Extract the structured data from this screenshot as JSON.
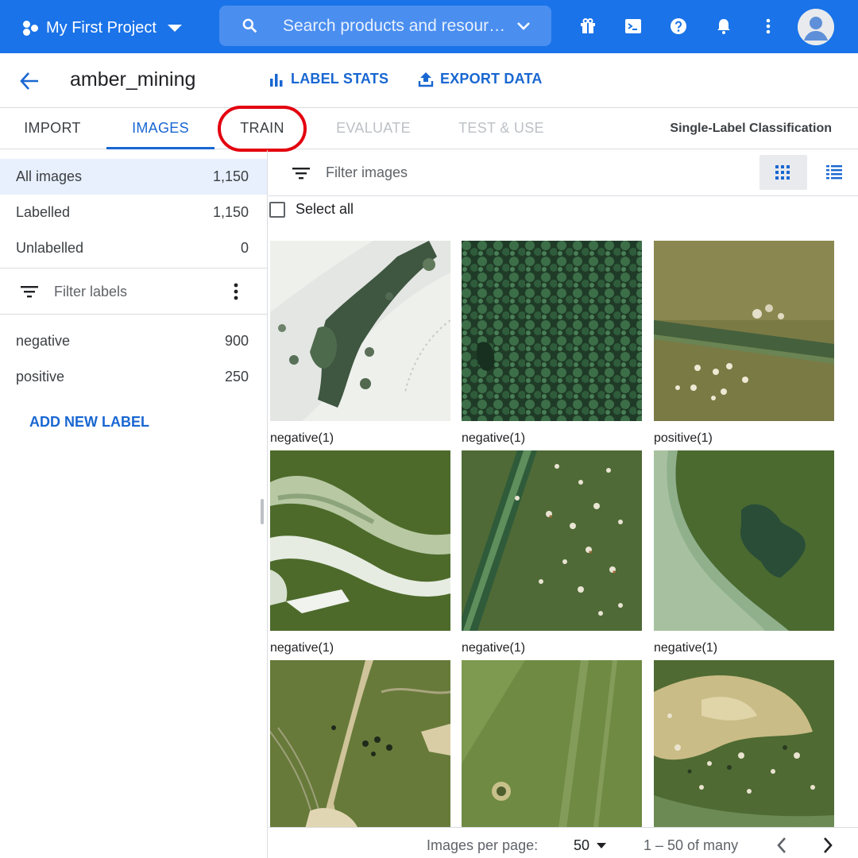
{
  "topbar": {
    "project": "My First Project",
    "search_placeholder": "Search products and resources",
    "icons": [
      "gift-icon",
      "terminal-icon",
      "help-icon",
      "bell-icon",
      "more-vert-icon",
      "account-icon"
    ]
  },
  "header": {
    "dataset_name": "amber_mining",
    "label_stats": "LABEL STATS",
    "export_data": "EXPORT DATA"
  },
  "tabs": [
    {
      "label": "IMPORT",
      "state": "normal"
    },
    {
      "label": "IMAGES",
      "state": "active"
    },
    {
      "label": "TRAIN",
      "state": "highlighted"
    },
    {
      "label": "EVALUATE",
      "state": "disabled"
    },
    {
      "label": "TEST & USE",
      "state": "disabled"
    }
  ],
  "model_type": "Single-Label Classification",
  "sidebar": {
    "counts": [
      {
        "label": "All images",
        "count": "1,150"
      },
      {
        "label": "Labelled",
        "count": "1,150"
      },
      {
        "label": "Unlabelled",
        "count": "0"
      }
    ],
    "filter_placeholder": "Filter labels",
    "labels": [
      {
        "label": "negative",
        "count": "900"
      },
      {
        "label": "positive",
        "count": "250"
      }
    ],
    "add_label": "ADD NEW LABEL"
  },
  "main": {
    "filter_placeholder": "Filter images",
    "select_all": "Select all",
    "images": [
      {
        "caption": "negative(1)",
        "scene": "snow-forest"
      },
      {
        "caption": "negative(1)",
        "scene": "dense-forest"
      },
      {
        "caption": "positive(1)",
        "scene": "field-pits"
      },
      {
        "caption": "negative(1)",
        "scene": "river-snow"
      },
      {
        "caption": "negative(1)",
        "scene": "road-pits"
      },
      {
        "caption": "negative(1)",
        "scene": "pond"
      },
      {
        "caption": "",
        "scene": "sandy-paths"
      },
      {
        "caption": "",
        "scene": "field-crater"
      },
      {
        "caption": "",
        "scene": "sand-pits"
      }
    ]
  },
  "pager": {
    "per_page_label": "Images per page:",
    "per_page": "50",
    "range": "1 – 50 of many"
  },
  "colors": {
    "brand": "#1a73e8",
    "accent": "#1967d2",
    "highlight_circle": "#e3000f"
  }
}
